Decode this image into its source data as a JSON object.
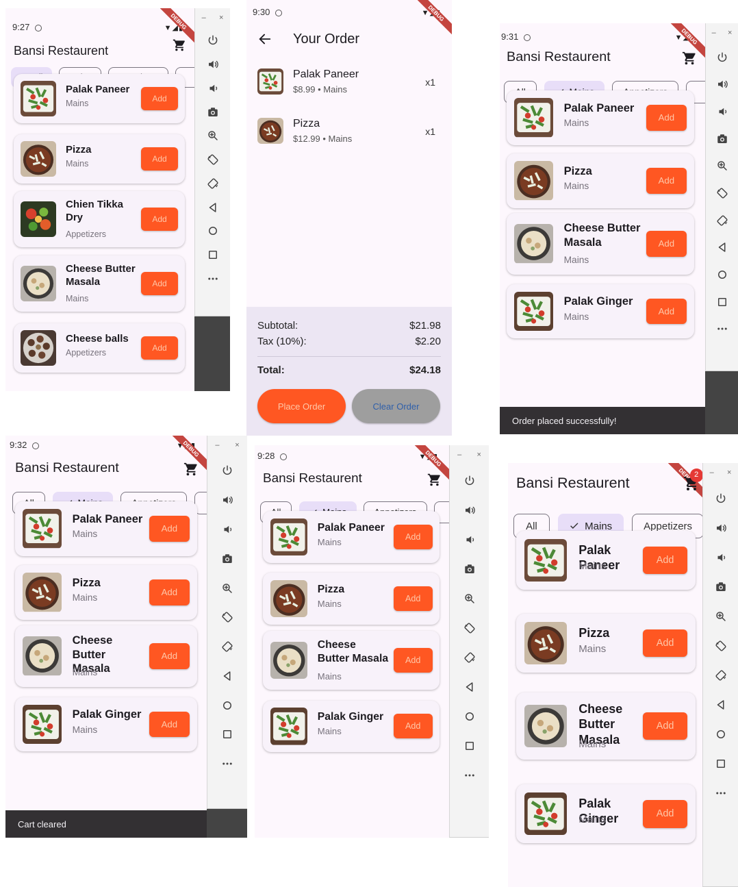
{
  "app": {
    "title": "Bansi Restaurent",
    "chips": [
      "All",
      "Mains",
      "Appetizers"
    ],
    "add_label": "Add",
    "colors": {
      "accent": "#ff5722",
      "selected_chip": "#e8def8",
      "card": "#f8f2fa",
      "background": "#fdf7fd"
    }
  },
  "emulator": {
    "minimize": "–",
    "close": "×",
    "debug_label": "DEBUG"
  },
  "shots": {
    "s1": {
      "time": "9:27",
      "items": [
        {
          "name": "Palak Paneer",
          "category": "Mains"
        },
        {
          "name": "Pizza",
          "category": "Mains"
        },
        {
          "name": "Chien Tikka Dry",
          "category": "Appetizers"
        },
        {
          "name": "Cheese Butter Masala",
          "category": "Mains"
        },
        {
          "name": "Cheese balls",
          "category": "Appetizers"
        }
      ]
    },
    "s2": {
      "time": "9:30",
      "title": "Your Order",
      "order_items": [
        {
          "name": "Palak Paneer",
          "detail": "$8.99 • Mains",
          "qty": "x1"
        },
        {
          "name": "Pizza",
          "detail": "$12.99 • Mains",
          "qty": "x1"
        }
      ],
      "subtotal_label": "Subtotal:",
      "subtotal": "$21.98",
      "tax_label": "Tax (10%):",
      "tax": "$2.20",
      "total_label": "Total:",
      "total": "$24.18",
      "place_order": "Place Order",
      "clear_order": "Clear Order"
    },
    "s3": {
      "time": "9:31",
      "items": [
        {
          "name": "Palak Paneer",
          "category": "Mains"
        },
        {
          "name": "Pizza",
          "category": "Mains"
        },
        {
          "name": "Cheese Butter Masala",
          "category": "Mains"
        },
        {
          "name": "Palak Ginger",
          "category": "Mains"
        }
      ],
      "snackbar": "Order placed successfully!"
    },
    "s4": {
      "time": "9:32",
      "items": [
        {
          "name": "Palak Paneer",
          "category": "Mains"
        },
        {
          "name": "Pizza",
          "category": "Mains"
        },
        {
          "name": "Cheese Butter Masala",
          "category": "Mains"
        },
        {
          "name": "Palak Ginger",
          "category": "Mains"
        }
      ],
      "snackbar": "Cart cleared"
    },
    "s5": {
      "time": "9:28",
      "items": [
        {
          "name": "Palak Paneer",
          "category": "Mains"
        },
        {
          "name": "Pizza",
          "category": "Mains"
        },
        {
          "name": "Cheese Butter Masala",
          "category": "Mains"
        },
        {
          "name": "Palak Ginger",
          "category": "Mains"
        }
      ]
    },
    "s6": {
      "cart_count": "2",
      "items": [
        {
          "name": "Palak Paneer",
          "category": "Mains"
        },
        {
          "name": "Pizza",
          "category": "Mains"
        },
        {
          "name": "Cheese Butter Masala",
          "category": "Mains"
        },
        {
          "name": "Palak Ginger",
          "category": "Mains"
        }
      ]
    }
  }
}
